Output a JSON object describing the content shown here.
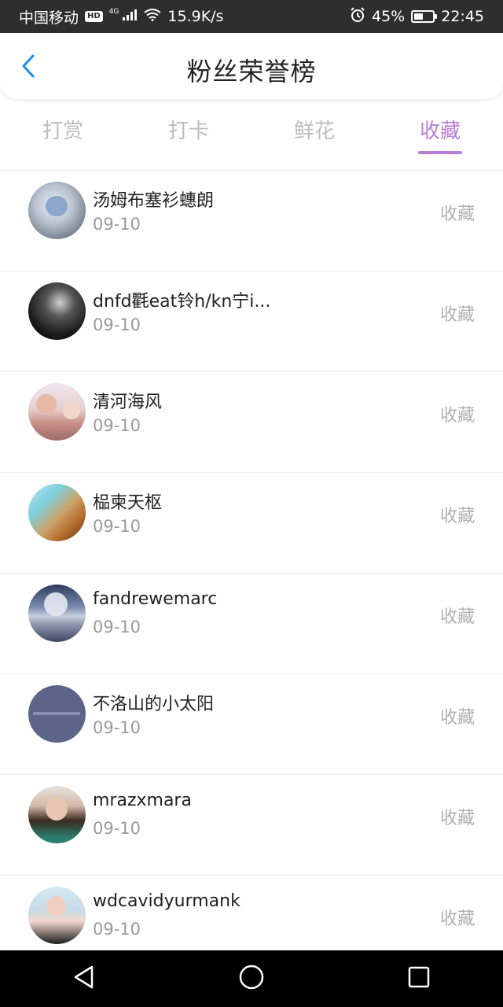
{
  "status_bar": {
    "carrier": "中国移动",
    "hd": "HD",
    "net": "4G",
    "speed": "15.9K/s",
    "battery": "45%",
    "time": "22:45"
  },
  "header": {
    "title": "粉丝荣誉榜"
  },
  "tabs": [
    {
      "label": "打赏"
    },
    {
      "label": "打卡"
    },
    {
      "label": "鲜花"
    },
    {
      "label": "收藏",
      "active": true
    }
  ],
  "list": [
    {
      "name": "汤姆布塞衫蟪朗",
      "date": "09-10",
      "action": "收藏"
    },
    {
      "name": "dnfd氍eat铃h/kn宁i...",
      "date": "09-10",
      "action": "收藏"
    },
    {
      "name": "清河海风",
      "date": "09-10",
      "action": "收藏"
    },
    {
      "name": "榀柬天枢",
      "date": "09-10",
      "action": "收藏"
    },
    {
      "name": "fandrewemarc",
      "date": "09-10",
      "action": "收藏"
    },
    {
      "name": "不洛山的小太阳",
      "date": "09-10",
      "action": "收藏"
    },
    {
      "name": "mrazxmara",
      "date": "09-10",
      "action": "收藏"
    },
    {
      "name": "wdcavidyurmank",
      "date": "09-10",
      "action": "收藏"
    }
  ],
  "colors": {
    "accent": "#b77fd6",
    "back_icon": "#1a8fe3",
    "status_bar_bg": "#2e2e2e"
  }
}
